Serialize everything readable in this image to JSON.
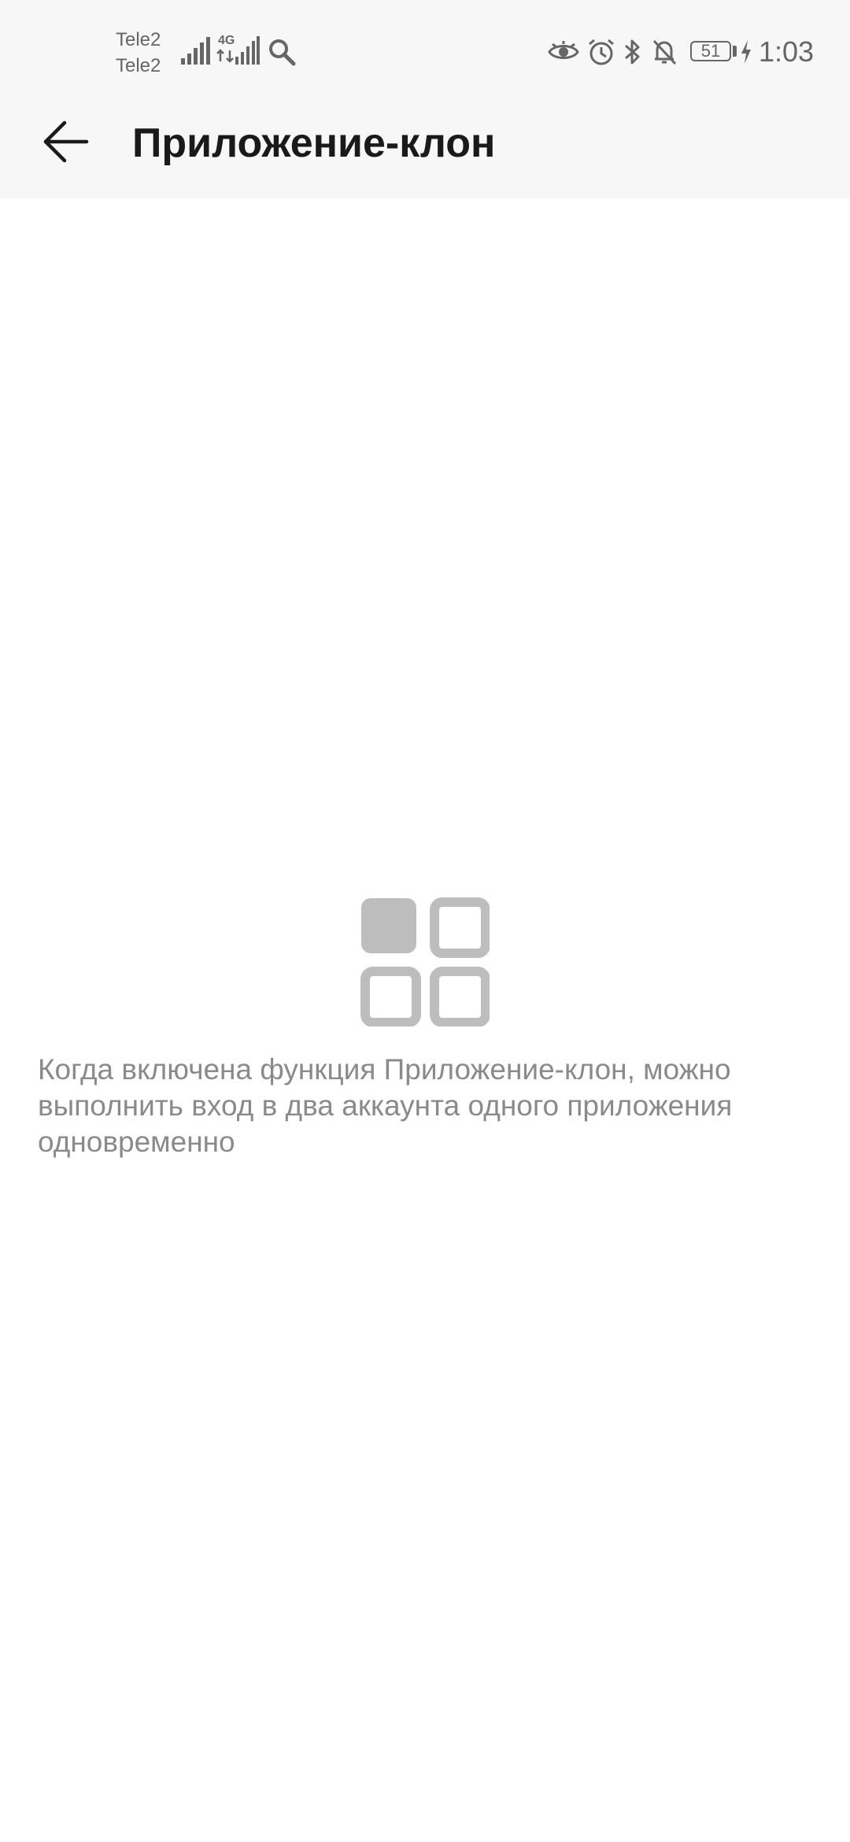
{
  "status_bar": {
    "carrier_1": "Tele2",
    "carrier_2": "Tele2",
    "network_type": "4G",
    "battery_level": "51",
    "time": "1:03",
    "icons": [
      "signal-icon",
      "signal-4g-icon",
      "search-icon",
      "eye-icon",
      "alarm-icon",
      "bluetooth-icon",
      "bell-off-icon",
      "battery-icon",
      "charging-icon"
    ]
  },
  "header": {
    "title": "Приложение-клон",
    "back_icon": "arrow-left-icon"
  },
  "empty_state": {
    "icon": "app-grid-icon",
    "message": "Когда включена функция Приложение-клон, можно выполнить вход в два аккаунта одного приложения одновременно"
  },
  "colors": {
    "header_background": "#f7f7f7",
    "page_background": "#ffffff",
    "title_text": "#1a1a1a",
    "secondary_text": "#8a8a8a",
    "icon_gray": "#bdbdbd",
    "status_gray": "#666666"
  }
}
